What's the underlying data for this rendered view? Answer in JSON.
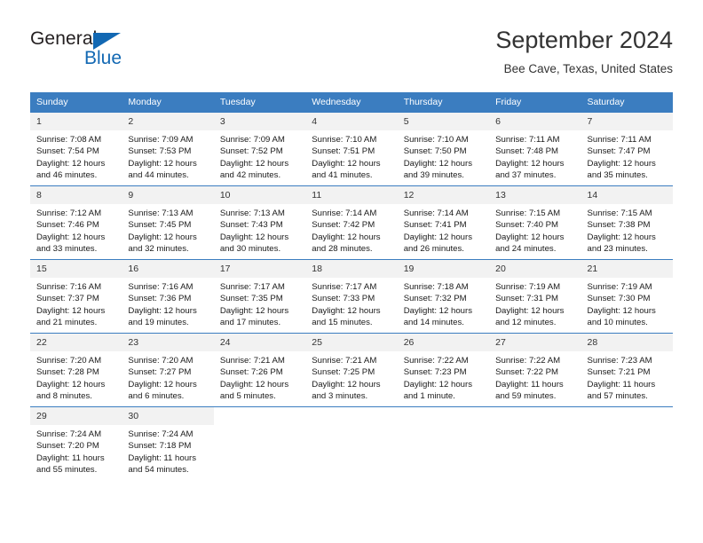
{
  "brand": {
    "name_part1": "General",
    "name_part2": "Blue",
    "logo_icon": "triangle-logo-icon",
    "accent_color": "#1268b3"
  },
  "header": {
    "title": "September 2024",
    "subtitle": "Bee Cave, Texas, United States"
  },
  "calendar": {
    "header_color": "#3b7dc0",
    "daynum_band_color": "#f2f2f2",
    "weekdays": [
      "Sunday",
      "Monday",
      "Tuesday",
      "Wednesday",
      "Thursday",
      "Friday",
      "Saturday"
    ],
    "weeks": [
      [
        {
          "day": "1",
          "lines": [
            "Sunrise: 7:08 AM",
            "Sunset: 7:54 PM",
            "Daylight: 12 hours",
            "and 46 minutes."
          ]
        },
        {
          "day": "2",
          "lines": [
            "Sunrise: 7:09 AM",
            "Sunset: 7:53 PM",
            "Daylight: 12 hours",
            "and 44 minutes."
          ]
        },
        {
          "day": "3",
          "lines": [
            "Sunrise: 7:09 AM",
            "Sunset: 7:52 PM",
            "Daylight: 12 hours",
            "and 42 minutes."
          ]
        },
        {
          "day": "4",
          "lines": [
            "Sunrise: 7:10 AM",
            "Sunset: 7:51 PM",
            "Daylight: 12 hours",
            "and 41 minutes."
          ]
        },
        {
          "day": "5",
          "lines": [
            "Sunrise: 7:10 AM",
            "Sunset: 7:50 PM",
            "Daylight: 12 hours",
            "and 39 minutes."
          ]
        },
        {
          "day": "6",
          "lines": [
            "Sunrise: 7:11 AM",
            "Sunset: 7:48 PM",
            "Daylight: 12 hours",
            "and 37 minutes."
          ]
        },
        {
          "day": "7",
          "lines": [
            "Sunrise: 7:11 AM",
            "Sunset: 7:47 PM",
            "Daylight: 12 hours",
            "and 35 minutes."
          ]
        }
      ],
      [
        {
          "day": "8",
          "lines": [
            "Sunrise: 7:12 AM",
            "Sunset: 7:46 PM",
            "Daylight: 12 hours",
            "and 33 minutes."
          ]
        },
        {
          "day": "9",
          "lines": [
            "Sunrise: 7:13 AM",
            "Sunset: 7:45 PM",
            "Daylight: 12 hours",
            "and 32 minutes."
          ]
        },
        {
          "day": "10",
          "lines": [
            "Sunrise: 7:13 AM",
            "Sunset: 7:43 PM",
            "Daylight: 12 hours",
            "and 30 minutes."
          ]
        },
        {
          "day": "11",
          "lines": [
            "Sunrise: 7:14 AM",
            "Sunset: 7:42 PM",
            "Daylight: 12 hours",
            "and 28 minutes."
          ]
        },
        {
          "day": "12",
          "lines": [
            "Sunrise: 7:14 AM",
            "Sunset: 7:41 PM",
            "Daylight: 12 hours",
            "and 26 minutes."
          ]
        },
        {
          "day": "13",
          "lines": [
            "Sunrise: 7:15 AM",
            "Sunset: 7:40 PM",
            "Daylight: 12 hours",
            "and 24 minutes."
          ]
        },
        {
          "day": "14",
          "lines": [
            "Sunrise: 7:15 AM",
            "Sunset: 7:38 PM",
            "Daylight: 12 hours",
            "and 23 minutes."
          ]
        }
      ],
      [
        {
          "day": "15",
          "lines": [
            "Sunrise: 7:16 AM",
            "Sunset: 7:37 PM",
            "Daylight: 12 hours",
            "and 21 minutes."
          ]
        },
        {
          "day": "16",
          "lines": [
            "Sunrise: 7:16 AM",
            "Sunset: 7:36 PM",
            "Daylight: 12 hours",
            "and 19 minutes."
          ]
        },
        {
          "day": "17",
          "lines": [
            "Sunrise: 7:17 AM",
            "Sunset: 7:35 PM",
            "Daylight: 12 hours",
            "and 17 minutes."
          ]
        },
        {
          "day": "18",
          "lines": [
            "Sunrise: 7:17 AM",
            "Sunset: 7:33 PM",
            "Daylight: 12 hours",
            "and 15 minutes."
          ]
        },
        {
          "day": "19",
          "lines": [
            "Sunrise: 7:18 AM",
            "Sunset: 7:32 PM",
            "Daylight: 12 hours",
            "and 14 minutes."
          ]
        },
        {
          "day": "20",
          "lines": [
            "Sunrise: 7:19 AM",
            "Sunset: 7:31 PM",
            "Daylight: 12 hours",
            "and 12 minutes."
          ]
        },
        {
          "day": "21",
          "lines": [
            "Sunrise: 7:19 AM",
            "Sunset: 7:30 PM",
            "Daylight: 12 hours",
            "and 10 minutes."
          ]
        }
      ],
      [
        {
          "day": "22",
          "lines": [
            "Sunrise: 7:20 AM",
            "Sunset: 7:28 PM",
            "Daylight: 12 hours",
            "and 8 minutes."
          ]
        },
        {
          "day": "23",
          "lines": [
            "Sunrise: 7:20 AM",
            "Sunset: 7:27 PM",
            "Daylight: 12 hours",
            "and 6 minutes."
          ]
        },
        {
          "day": "24",
          "lines": [
            "Sunrise: 7:21 AM",
            "Sunset: 7:26 PM",
            "Daylight: 12 hours",
            "and 5 minutes."
          ]
        },
        {
          "day": "25",
          "lines": [
            "Sunrise: 7:21 AM",
            "Sunset: 7:25 PM",
            "Daylight: 12 hours",
            "and 3 minutes."
          ]
        },
        {
          "day": "26",
          "lines": [
            "Sunrise: 7:22 AM",
            "Sunset: 7:23 PM",
            "Daylight: 12 hours",
            "and 1 minute."
          ]
        },
        {
          "day": "27",
          "lines": [
            "Sunrise: 7:22 AM",
            "Sunset: 7:22 PM",
            "Daylight: 11 hours",
            "and 59 minutes."
          ]
        },
        {
          "day": "28",
          "lines": [
            "Sunrise: 7:23 AM",
            "Sunset: 7:21 PM",
            "Daylight: 11 hours",
            "and 57 minutes."
          ]
        }
      ],
      [
        {
          "day": "29",
          "lines": [
            "Sunrise: 7:24 AM",
            "Sunset: 7:20 PM",
            "Daylight: 11 hours",
            "and 55 minutes."
          ]
        },
        {
          "day": "30",
          "lines": [
            "Sunrise: 7:24 AM",
            "Sunset: 7:18 PM",
            "Daylight: 11 hours",
            "and 54 minutes."
          ]
        },
        {
          "day": "",
          "lines": []
        },
        {
          "day": "",
          "lines": []
        },
        {
          "day": "",
          "lines": []
        },
        {
          "day": "",
          "lines": []
        },
        {
          "day": "",
          "lines": []
        }
      ]
    ]
  }
}
